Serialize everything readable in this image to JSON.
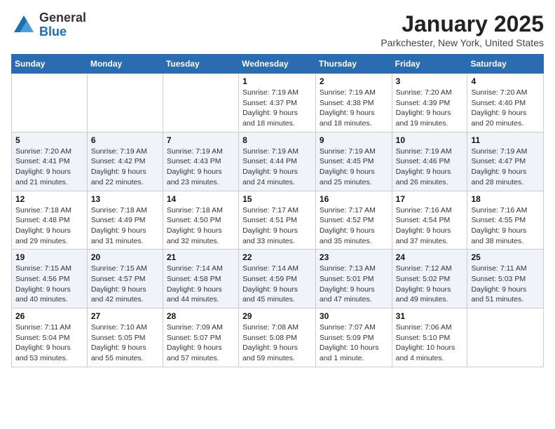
{
  "header": {
    "logo_general": "General",
    "logo_blue": "Blue",
    "month_title": "January 2025",
    "location": "Parkchester, New York, United States"
  },
  "weekdays": [
    "Sunday",
    "Monday",
    "Tuesday",
    "Wednesday",
    "Thursday",
    "Friday",
    "Saturday"
  ],
  "weeks": [
    [
      {
        "day": "",
        "info": ""
      },
      {
        "day": "",
        "info": ""
      },
      {
        "day": "",
        "info": ""
      },
      {
        "day": "1",
        "info": "Sunrise: 7:19 AM\nSunset: 4:37 PM\nDaylight: 9 hours\nand 18 minutes."
      },
      {
        "day": "2",
        "info": "Sunrise: 7:19 AM\nSunset: 4:38 PM\nDaylight: 9 hours\nand 18 minutes."
      },
      {
        "day": "3",
        "info": "Sunrise: 7:20 AM\nSunset: 4:39 PM\nDaylight: 9 hours\nand 19 minutes."
      },
      {
        "day": "4",
        "info": "Sunrise: 7:20 AM\nSunset: 4:40 PM\nDaylight: 9 hours\nand 20 minutes."
      }
    ],
    [
      {
        "day": "5",
        "info": "Sunrise: 7:20 AM\nSunset: 4:41 PM\nDaylight: 9 hours\nand 21 minutes."
      },
      {
        "day": "6",
        "info": "Sunrise: 7:19 AM\nSunset: 4:42 PM\nDaylight: 9 hours\nand 22 minutes."
      },
      {
        "day": "7",
        "info": "Sunrise: 7:19 AM\nSunset: 4:43 PM\nDaylight: 9 hours\nand 23 minutes."
      },
      {
        "day": "8",
        "info": "Sunrise: 7:19 AM\nSunset: 4:44 PM\nDaylight: 9 hours\nand 24 minutes."
      },
      {
        "day": "9",
        "info": "Sunrise: 7:19 AM\nSunset: 4:45 PM\nDaylight: 9 hours\nand 25 minutes."
      },
      {
        "day": "10",
        "info": "Sunrise: 7:19 AM\nSunset: 4:46 PM\nDaylight: 9 hours\nand 26 minutes."
      },
      {
        "day": "11",
        "info": "Sunrise: 7:19 AM\nSunset: 4:47 PM\nDaylight: 9 hours\nand 28 minutes."
      }
    ],
    [
      {
        "day": "12",
        "info": "Sunrise: 7:18 AM\nSunset: 4:48 PM\nDaylight: 9 hours\nand 29 minutes."
      },
      {
        "day": "13",
        "info": "Sunrise: 7:18 AM\nSunset: 4:49 PM\nDaylight: 9 hours\nand 31 minutes."
      },
      {
        "day": "14",
        "info": "Sunrise: 7:18 AM\nSunset: 4:50 PM\nDaylight: 9 hours\nand 32 minutes."
      },
      {
        "day": "15",
        "info": "Sunrise: 7:17 AM\nSunset: 4:51 PM\nDaylight: 9 hours\nand 33 minutes."
      },
      {
        "day": "16",
        "info": "Sunrise: 7:17 AM\nSunset: 4:52 PM\nDaylight: 9 hours\nand 35 minutes."
      },
      {
        "day": "17",
        "info": "Sunrise: 7:16 AM\nSunset: 4:54 PM\nDaylight: 9 hours\nand 37 minutes."
      },
      {
        "day": "18",
        "info": "Sunrise: 7:16 AM\nSunset: 4:55 PM\nDaylight: 9 hours\nand 38 minutes."
      }
    ],
    [
      {
        "day": "19",
        "info": "Sunrise: 7:15 AM\nSunset: 4:56 PM\nDaylight: 9 hours\nand 40 minutes."
      },
      {
        "day": "20",
        "info": "Sunrise: 7:15 AM\nSunset: 4:57 PM\nDaylight: 9 hours\nand 42 minutes."
      },
      {
        "day": "21",
        "info": "Sunrise: 7:14 AM\nSunset: 4:58 PM\nDaylight: 9 hours\nand 44 minutes."
      },
      {
        "day": "22",
        "info": "Sunrise: 7:14 AM\nSunset: 4:59 PM\nDaylight: 9 hours\nand 45 minutes."
      },
      {
        "day": "23",
        "info": "Sunrise: 7:13 AM\nSunset: 5:01 PM\nDaylight: 9 hours\nand 47 minutes."
      },
      {
        "day": "24",
        "info": "Sunrise: 7:12 AM\nSunset: 5:02 PM\nDaylight: 9 hours\nand 49 minutes."
      },
      {
        "day": "25",
        "info": "Sunrise: 7:11 AM\nSunset: 5:03 PM\nDaylight: 9 hours\nand 51 minutes."
      }
    ],
    [
      {
        "day": "26",
        "info": "Sunrise: 7:11 AM\nSunset: 5:04 PM\nDaylight: 9 hours\nand 53 minutes."
      },
      {
        "day": "27",
        "info": "Sunrise: 7:10 AM\nSunset: 5:05 PM\nDaylight: 9 hours\nand 55 minutes."
      },
      {
        "day": "28",
        "info": "Sunrise: 7:09 AM\nSunset: 5:07 PM\nDaylight: 9 hours\nand 57 minutes."
      },
      {
        "day": "29",
        "info": "Sunrise: 7:08 AM\nSunset: 5:08 PM\nDaylight: 9 hours\nand 59 minutes."
      },
      {
        "day": "30",
        "info": "Sunrise: 7:07 AM\nSunset: 5:09 PM\nDaylight: 10 hours\nand 1 minute."
      },
      {
        "day": "31",
        "info": "Sunrise: 7:06 AM\nSunset: 5:10 PM\nDaylight: 10 hours\nand 4 minutes."
      },
      {
        "day": "",
        "info": ""
      }
    ]
  ]
}
